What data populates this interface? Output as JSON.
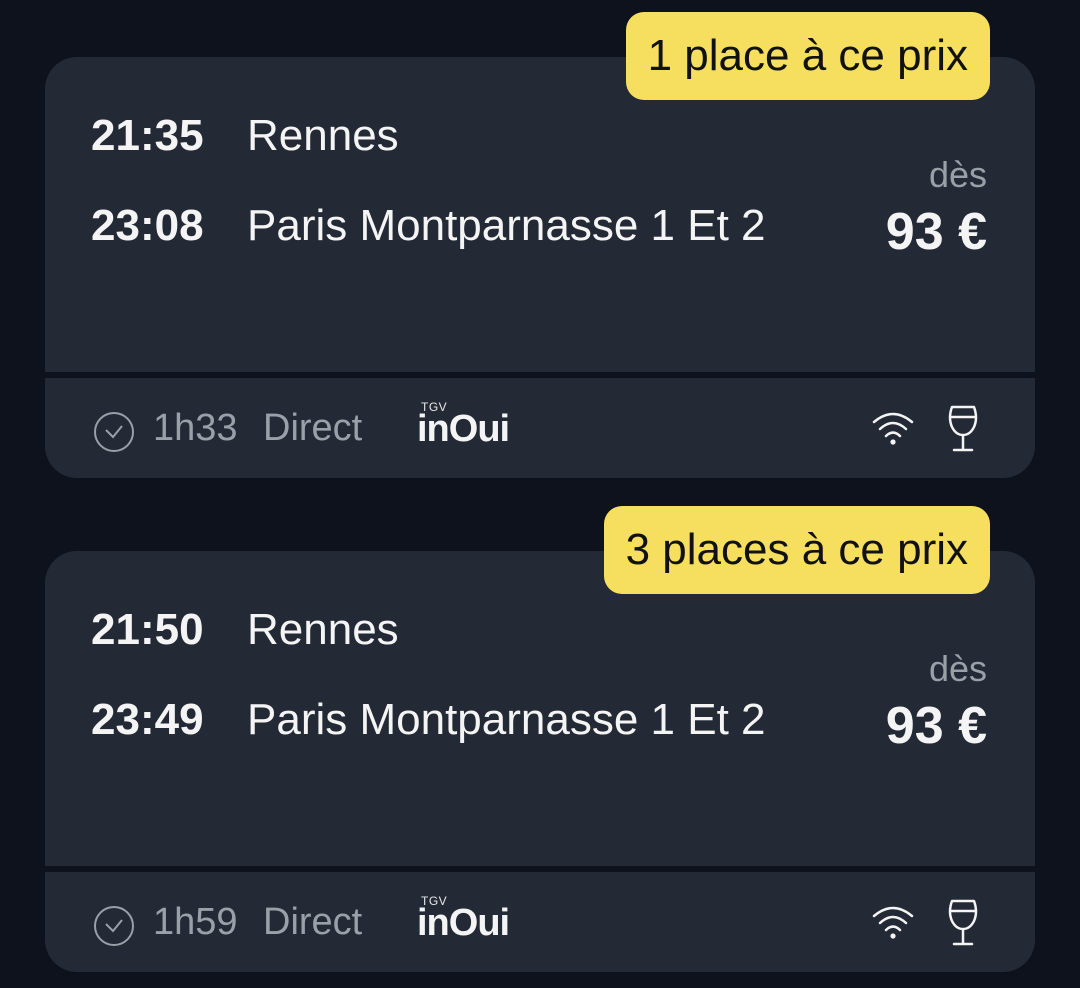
{
  "colors": {
    "background": "#0d121c",
    "card": "#242a35",
    "badge": "#f6df5e",
    "text_primary": "#f4f4f4",
    "text_secondary": "#9aa0a8"
  },
  "journeys": [
    {
      "badge": "1 place à ce prix",
      "departure_time": "21:35",
      "departure_station": "Rennes",
      "arrival_time": "23:08",
      "arrival_station": "Paris Montparnasse 1 Et 2",
      "price_prefix": "dès",
      "price": "93 €",
      "duration": "1h33",
      "connection": "Direct",
      "brand_small": "TGV",
      "brand": "inOui",
      "icons": [
        "clock-icon",
        "wifi-icon",
        "wine-glass-icon"
      ]
    },
    {
      "badge": "3 places à ce prix",
      "departure_time": "21:50",
      "departure_station": "Rennes",
      "arrival_time": "23:49",
      "arrival_station": "Paris Montparnasse 1 Et 2",
      "price_prefix": "dès",
      "price": "93 €",
      "duration": "1h59",
      "connection": "Direct",
      "brand_small": "TGV",
      "brand": "inOui",
      "icons": [
        "clock-icon",
        "wifi-icon",
        "wine-glass-icon"
      ]
    }
  ]
}
